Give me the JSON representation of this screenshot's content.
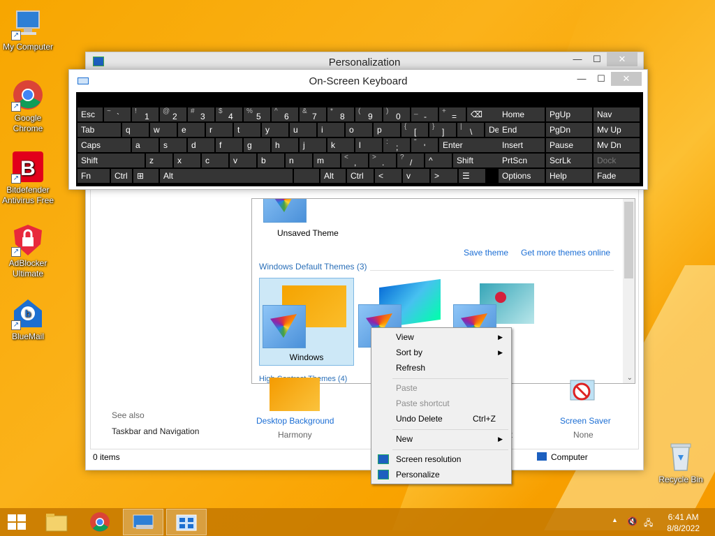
{
  "desktop": {
    "icons": [
      {
        "label": "My Computer"
      },
      {
        "label": "Google Chrome"
      },
      {
        "label": "Bitdefender Antivirus Free"
      },
      {
        "label": "AdBlocker Ultimate"
      },
      {
        "label": "BlueMail"
      },
      {
        "label": "Recycle Bin"
      }
    ]
  },
  "personalization": {
    "title": "Personalization",
    "unsaved_theme": "Unsaved Theme",
    "save_theme": "Save theme",
    "get_more": "Get more themes online",
    "default_themes_header": "Windows Default Themes (3)",
    "theme_windows": "Windows",
    "theme_lines_partial": "L",
    "high_contrast_partial": "High Contrast Themes (4)",
    "see_also": "See also",
    "taskbar_nav": "Taskbar and Navigation",
    "desktop_background": "Desktop Background",
    "desktop_background_value": "Harmony",
    "color_partial": "lt",
    "screen_saver": "Screen Saver",
    "screen_saver_value": "None",
    "status_items": "0 items",
    "status_computer": "Computer"
  },
  "osk": {
    "title": "On-Screen Keyboard",
    "rows": [
      [
        {
          "t": "Esc"
        },
        {
          "t": "~ `"
        },
        {
          "t": "! 1"
        },
        {
          "t": "@ 2"
        },
        {
          "t": "# 3"
        },
        {
          "t": "$ 4"
        },
        {
          "t": "% 5"
        },
        {
          "t": "^ 6"
        },
        {
          "t": "& 7"
        },
        {
          "t": "* 8"
        },
        {
          "t": "( 9"
        },
        {
          "t": ") 0"
        },
        {
          "t": "_ -"
        },
        {
          "t": "+ ="
        },
        {
          "t": "⌫"
        },
        {
          "t": "Home"
        },
        {
          "t": "PgUp"
        },
        {
          "t": "Nav"
        }
      ],
      [
        {
          "t": "Tab"
        },
        {
          "t": "q"
        },
        {
          "t": "w"
        },
        {
          "t": "e"
        },
        {
          "t": "r"
        },
        {
          "t": "t"
        },
        {
          "t": "y"
        },
        {
          "t": "u"
        },
        {
          "t": "i"
        },
        {
          "t": "o"
        },
        {
          "t": "p"
        },
        {
          "t": "{ ["
        },
        {
          "t": "} ]"
        },
        {
          "t": "| \\"
        },
        {
          "t": "Del"
        },
        {
          "t": "End"
        },
        {
          "t": "PgDn"
        },
        {
          "t": "Mv Up"
        }
      ],
      [
        {
          "t": "Caps"
        },
        {
          "t": "a"
        },
        {
          "t": "s"
        },
        {
          "t": "d"
        },
        {
          "t": "f"
        },
        {
          "t": "g"
        },
        {
          "t": "h"
        },
        {
          "t": "j"
        },
        {
          "t": "k"
        },
        {
          "t": "l"
        },
        {
          "t": ": ;"
        },
        {
          "t": "\" '"
        },
        {
          "t": "Enter"
        },
        {
          "t": "Insert"
        },
        {
          "t": "Pause"
        },
        {
          "t": "Mv Dn"
        }
      ],
      [
        {
          "t": "Shift"
        },
        {
          "t": "z"
        },
        {
          "t": "x"
        },
        {
          "t": "c"
        },
        {
          "t": "v"
        },
        {
          "t": "b"
        },
        {
          "t": "n"
        },
        {
          "t": "m"
        },
        {
          "t": "< ,"
        },
        {
          "t": "> ."
        },
        {
          "t": "? /"
        },
        {
          "t": "^"
        },
        {
          "t": "Shift"
        },
        {
          "t": "PrtScn"
        },
        {
          "t": "ScrLk"
        },
        {
          "t": "Dock"
        }
      ],
      [
        {
          "t": "Fn"
        },
        {
          "t": "Ctrl"
        },
        {
          "t": "⊞"
        },
        {
          "t": "Alt"
        },
        {
          "t": ""
        },
        {
          "t": "Alt"
        },
        {
          "t": "Ctrl"
        },
        {
          "t": "<"
        },
        {
          "t": "v"
        },
        {
          "t": ">"
        },
        {
          "t": "☰"
        },
        {
          "t": "Options"
        },
        {
          "t": "Help"
        },
        {
          "t": "Fade"
        }
      ]
    ]
  },
  "context_menu": {
    "view": "View",
    "sort_by": "Sort by",
    "refresh": "Refresh",
    "paste": "Paste",
    "paste_shortcut": "Paste shortcut",
    "undo_delete": "Undo Delete",
    "undo_shortcut": "Ctrl+Z",
    "new": "New",
    "screen_resolution": "Screen resolution",
    "personalize": "Personalize"
  },
  "taskbar": {
    "time": "6:41 AM",
    "date": "8/8/2022"
  }
}
